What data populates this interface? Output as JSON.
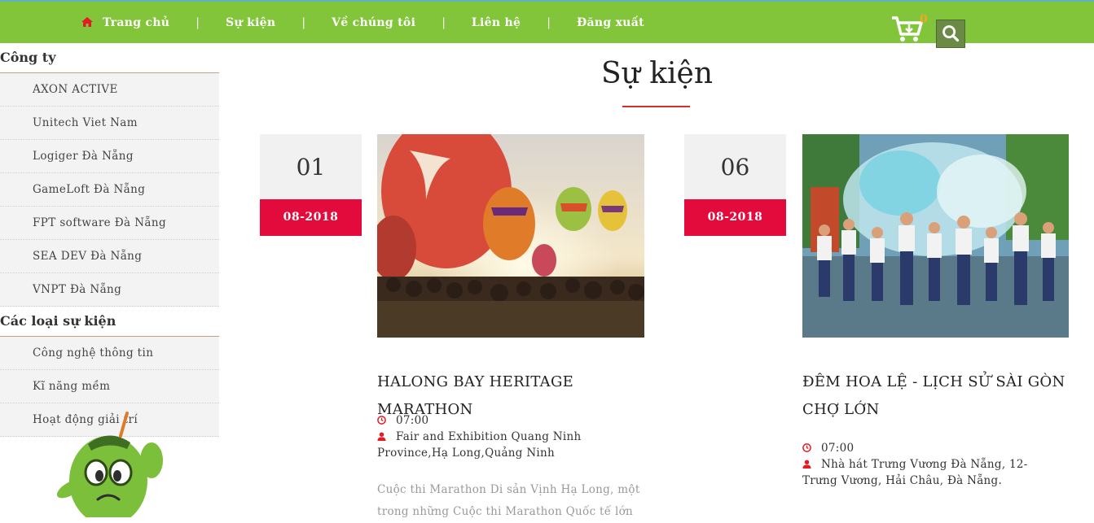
{
  "nav": {
    "items": [
      "Trang chủ",
      "Sự kiện",
      "Về chúng tôi",
      "Liên hệ",
      "Đăng xuất"
    ],
    "separator": "|",
    "cart_count": "0"
  },
  "sidebar": {
    "section1": {
      "heading": "Công ty",
      "items": [
        "AXON ACTIVE",
        "Unitech Viet Nam",
        "Logiger Đà Nẵng",
        "GameLoft Đà Nẵng",
        "FPT software Đà Nẵng",
        "SEA DEV Đà Nẵng",
        "VNPT Đà Nẵng"
      ]
    },
    "section2": {
      "heading": "Các loại sự kiện",
      "items": [
        "Công nghệ thông tin",
        "Kĩ năng mềm",
        "Hoạt động giải trí"
      ]
    }
  },
  "main": {
    "title": "Sự kiện",
    "events": [
      {
        "day": "01",
        "month": "08-2018",
        "title": "HALONG BAY HERITAGE MARATHON",
        "time": "07:00",
        "location": "Fair and Exhibition Quang Ninh Province,Hạ Long,Quảng Ninh",
        "description": "Cuộc thi Marathon Di sản Vịnh Hạ Long, một trong những Cuộc thi Marathon Quốc tế lớn"
      },
      {
        "day": "06",
        "month": "08-2018",
        "title": "ĐÊM HOA LỆ - LỊCH SỬ SÀI GÒN CHỢ LỚN",
        "time": "07:00",
        "location": "Nhà hát Trưng Vương Đà Nẵng, 12-Trưng Vương, Hải Châu, Đà Nẵng.",
        "description": ""
      }
    ]
  },
  "colors": {
    "nav_green": "#82c53b",
    "date_red": "#e30b3b",
    "accent_red": "#d32f2f"
  },
  "icons": [
    "home-icon",
    "cart-icon",
    "search-icon",
    "clock-icon",
    "user-icon"
  ]
}
